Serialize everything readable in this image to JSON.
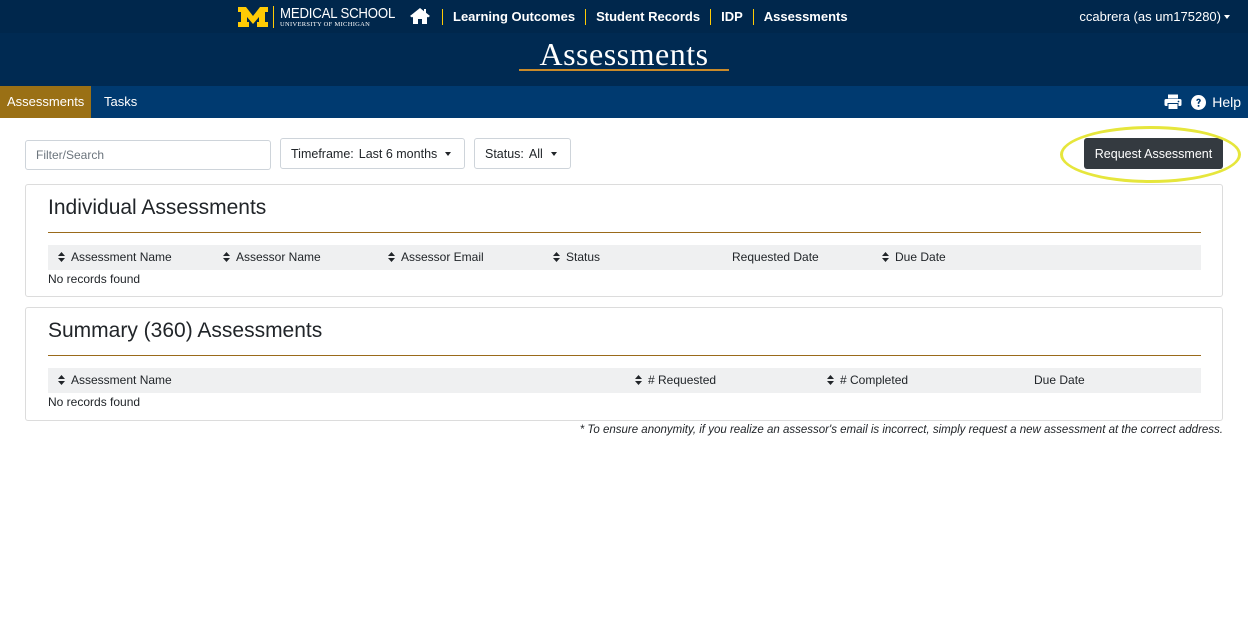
{
  "colors": {
    "nav_dark": "#00274c",
    "title_bar": "#002a52",
    "tab_bar": "#003a70",
    "active_tab": "#9a7015",
    "maize": "#ffcb05",
    "button_dark": "#343a40",
    "highlight": "#e6e63c"
  },
  "header": {
    "logo_main": "MEDICAL SCHOOL",
    "logo_sub": "UNIVERSITY OF MICHIGAN",
    "home_icon": "home-icon",
    "nav": [
      {
        "label": "Learning Outcomes"
      },
      {
        "label": "Student Records"
      },
      {
        "label": "IDP"
      },
      {
        "label": "Assessments"
      }
    ],
    "user": "ccabrera (as um175280)"
  },
  "page_title": "Assessments",
  "tabs": [
    {
      "label": "Assessments",
      "active": true
    },
    {
      "label": "Tasks",
      "active": false
    }
  ],
  "tools": {
    "print_icon": "printer-icon",
    "help_icon": "question-circle-icon",
    "help_label": "Help"
  },
  "filters": {
    "search_placeholder": "Filter/Search",
    "timeframe_label": "Timeframe:",
    "timeframe_value": "Last 6 months",
    "status_label": "Status:",
    "status_value": "All"
  },
  "request_button": "Request Assessment",
  "individual": {
    "title": "Individual Assessments",
    "columns": [
      {
        "label": "Assessment Name",
        "sortable": true
      },
      {
        "label": "Assessor Name",
        "sortable": true
      },
      {
        "label": "Assessor Email",
        "sortable": true
      },
      {
        "label": "Status",
        "sortable": true
      },
      {
        "label": "Requested Date",
        "sortable": false
      },
      {
        "label": "Due Date",
        "sortable": true
      }
    ],
    "empty_text": "No records found"
  },
  "summary": {
    "title": "Summary (360) Assessments",
    "columns": [
      {
        "label": "Assessment Name",
        "sortable": true
      },
      {
        "label": "# Requested",
        "sortable": true
      },
      {
        "label": "# Completed",
        "sortable": true
      },
      {
        "label": "Due Date",
        "sortable": false
      }
    ],
    "empty_text": "No records found"
  },
  "footnote": "* To ensure anonymity, if you realize an assessor's email is incorrect, simply request a new assessment at the correct address."
}
